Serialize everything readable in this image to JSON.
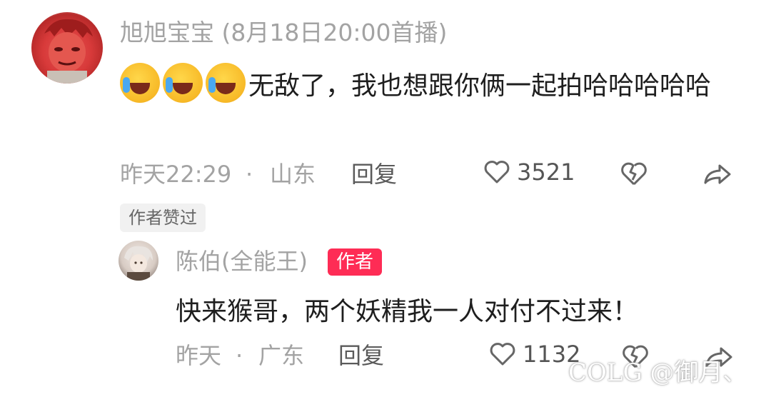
{
  "comment": {
    "username": "旭旭宝宝",
    "broadcast_note": "(8月18日20:00首播)",
    "text": "无敌了，我也想跟你俩一起拍哈哈哈哈哈",
    "time": "昨天22:29",
    "dot": "·",
    "location": "山东",
    "reply_label": "回复",
    "likes": "3521",
    "author_liked_badge": "作者赞过",
    "emoji_icons": [
      "laughing-crying-emoji",
      "laughing-crying-emoji",
      "laughing-crying-emoji"
    ]
  },
  "reply": {
    "username": "陈伯(全能王)",
    "author_tag": "作者",
    "text": "快来猴哥，两个妖精我一人对付不过来！",
    "time": "昨天",
    "dot": "·",
    "location": "广东",
    "reply_label": "回复",
    "likes": "1132"
  },
  "watermark": "COLG @御月、",
  "colors": {
    "author_tag_bg": "#fe2c55",
    "meta_gray": "#a3a3a3"
  }
}
